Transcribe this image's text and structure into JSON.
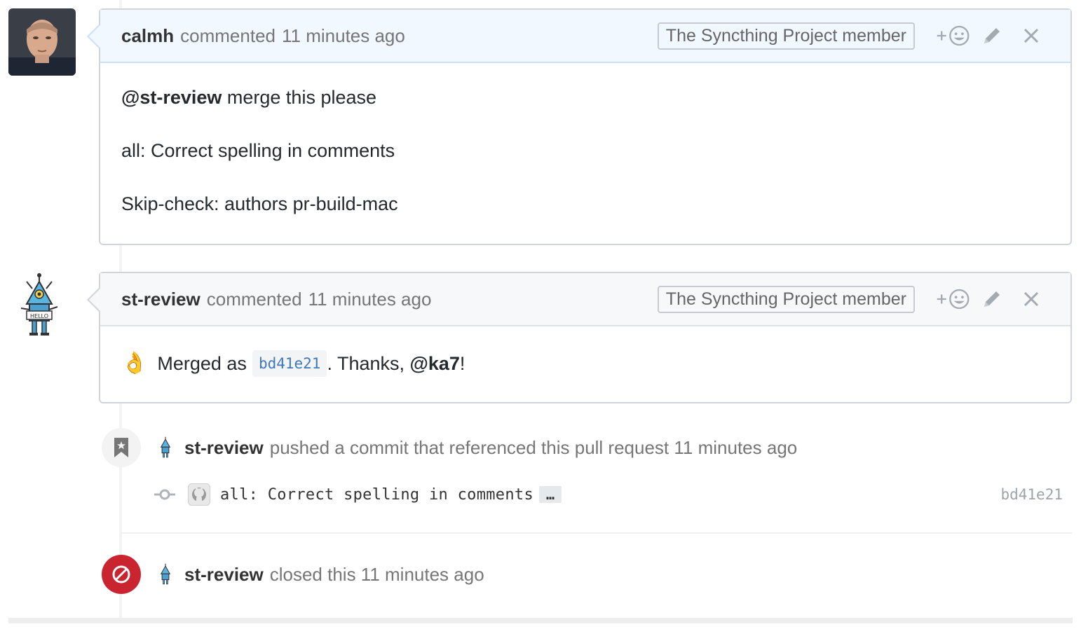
{
  "comments": [
    {
      "author": "calmh",
      "action": "commented",
      "time": "11 minutes ago",
      "badge": "The Syncthing Project member",
      "body": {
        "mention": "@st-review",
        "line1_rest": " merge this please",
        "line2": "all: Correct spelling in comments",
        "line3": "Skip-check: authors pr-build-mac"
      }
    },
    {
      "author": "st-review",
      "action": "commented",
      "time": "11 minutes ago",
      "badge": "The Syncthing Project member",
      "body": {
        "emoji": "👌",
        "merged_as": "Merged as",
        "sha": "bd41e21",
        "thanks": ". Thanks, ",
        "mention": "@ka7",
        "end": "!"
      }
    }
  ],
  "events": {
    "push": {
      "author": "st-review",
      "text": "pushed a commit that referenced this pull request 11 minutes ago"
    },
    "commit": {
      "message": "all: Correct spelling in comments",
      "ellipsis": "…",
      "sha": "bd41e21"
    },
    "closed": {
      "author": "st-review",
      "text": "closed this 11 minutes ago"
    }
  },
  "icons": {
    "add_reaction": "add-reaction-icon",
    "edit": "pencil-icon",
    "delete": "close-icon",
    "bookmark": "bookmark-icon",
    "closed": "circle-slash-icon",
    "commit": "git-commit-icon"
  },
  "colors": {
    "closed_red": "#cb2431",
    "link_blue": "#4078c0",
    "header_blue": "#f1f8ff"
  }
}
